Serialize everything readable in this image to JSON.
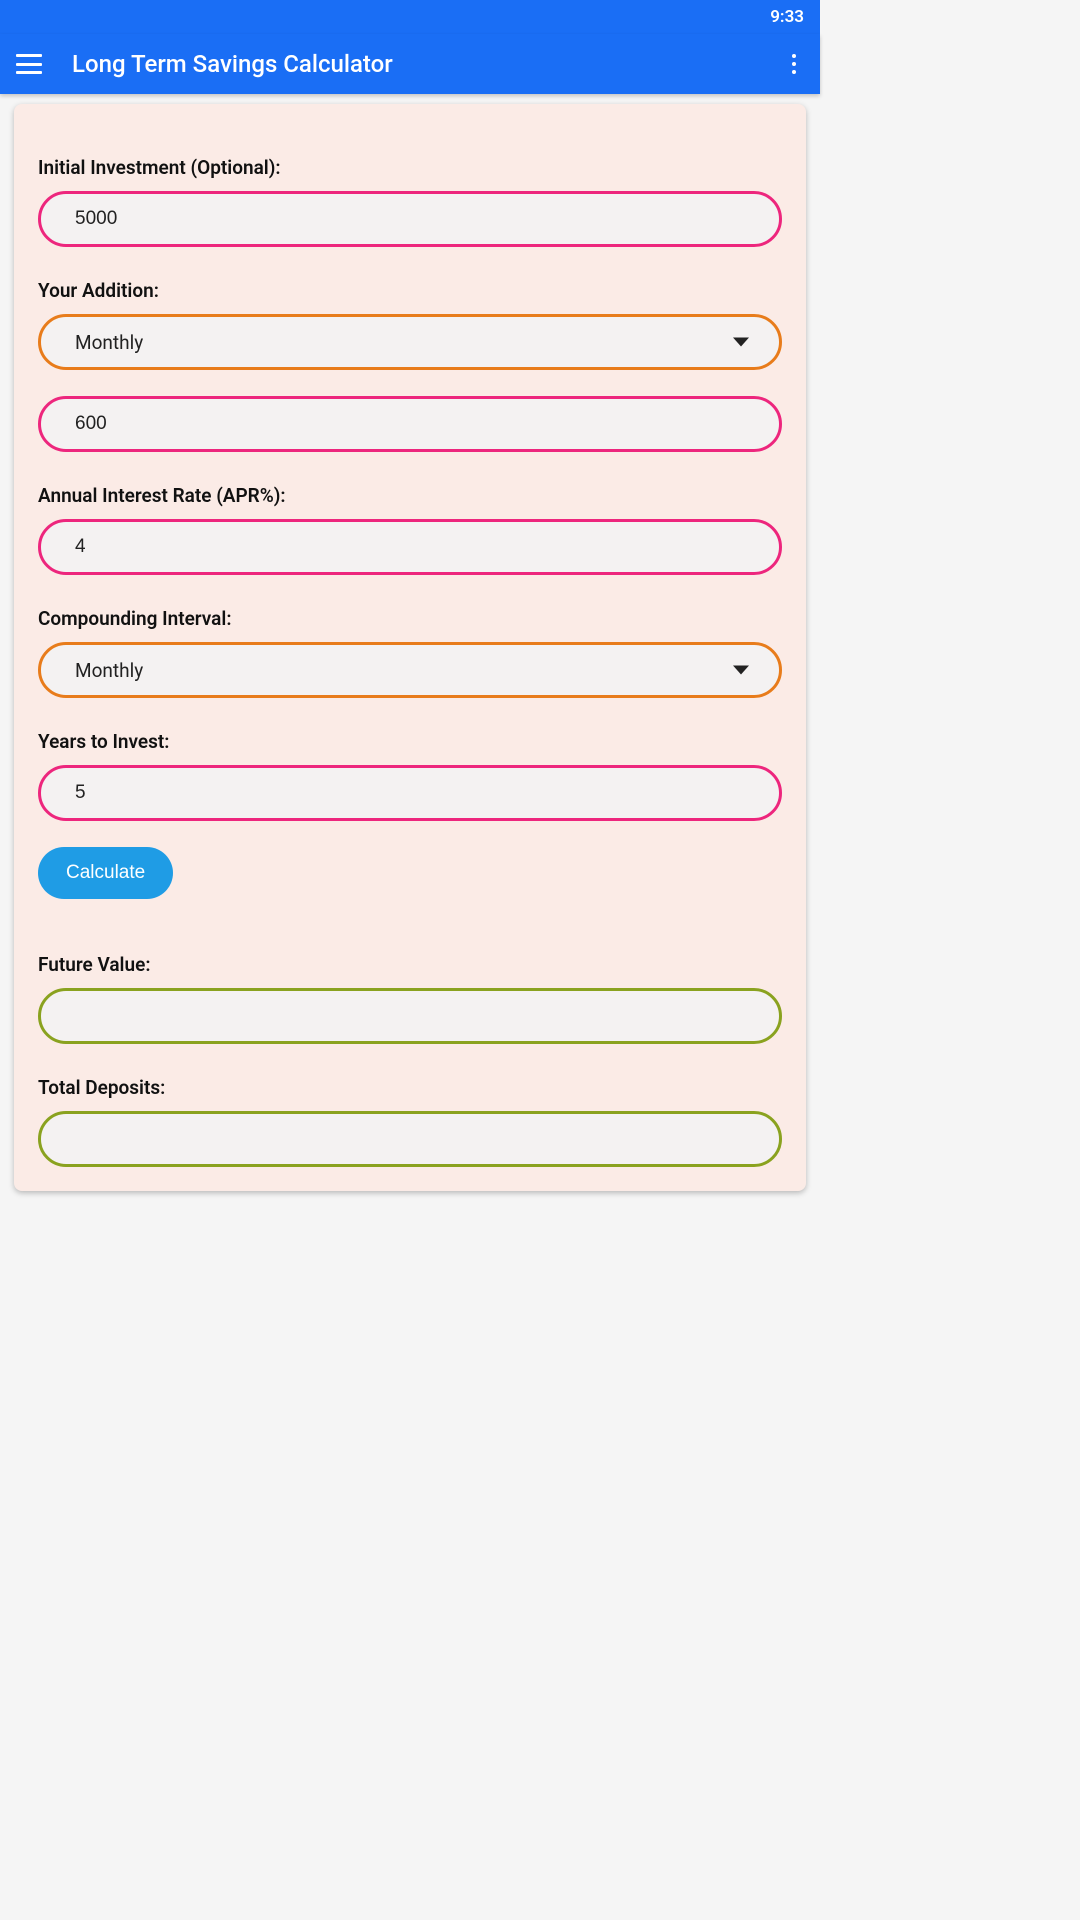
{
  "status": {
    "time": "9:33"
  },
  "appbar": {
    "title": "Long Term Savings Calculator"
  },
  "form": {
    "initialInvestment": {
      "label": "Initial Investment (Optional):",
      "value": "5000"
    },
    "addition": {
      "label": "Your Addition:",
      "frequency": "Monthly",
      "amount": "600"
    },
    "apr": {
      "label": "Annual Interest Rate (APR%):",
      "value": "4"
    },
    "compounding": {
      "label": "Compounding Interval:",
      "value": "Monthly"
    },
    "years": {
      "label": "Years to Invest:",
      "value": "5"
    },
    "calculate": "Calculate",
    "futureValue": {
      "label": "Future Value:",
      "value": ""
    },
    "totalDeposits": {
      "label": "Total Deposits:",
      "value": ""
    }
  }
}
